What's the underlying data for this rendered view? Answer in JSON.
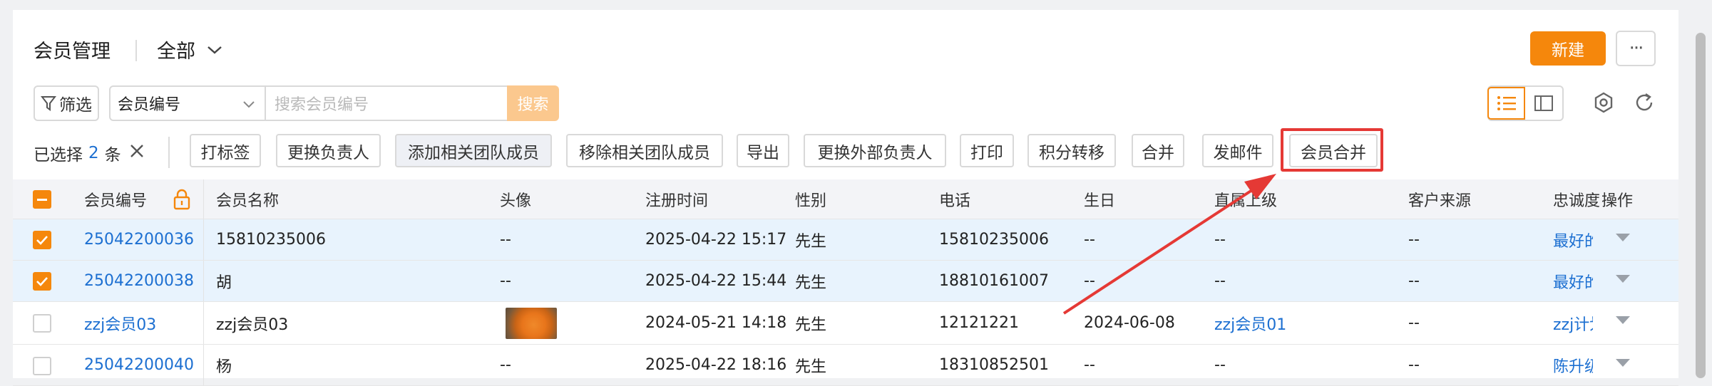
{
  "header": {
    "title": "会员管理",
    "view": "全部",
    "new_label": "新建",
    "more_label": "···"
  },
  "filterbar": {
    "filter_label": "筛选",
    "field_select": "会员编号",
    "search_placeholder": "搜索会员编号",
    "search_label": "搜索"
  },
  "selection": {
    "prefix": "已选择",
    "count": "2",
    "suffix": "条"
  },
  "actions": [
    {
      "label": "打标签"
    },
    {
      "label": "更换负责人"
    },
    {
      "label": "添加相关团队成员"
    },
    {
      "label": "移除相关团队成员"
    },
    {
      "label": "导出"
    },
    {
      "label": "更换外部负责人"
    },
    {
      "label": "打印"
    },
    {
      "label": "积分转移"
    },
    {
      "label": "合并"
    },
    {
      "label": "发邮件"
    },
    {
      "label": "会员合并"
    }
  ],
  "table": {
    "columns": [
      "会员编号",
      "会员名称",
      "头像",
      "注册时间",
      "性别",
      "电话",
      "生日",
      "直属上级",
      "客户来源",
      "忠诚度",
      "操作"
    ],
    "rows": [
      {
        "selected": true,
        "id": "25042200036",
        "name": "15810235006",
        "avatar": "--",
        "registered": "2025-04-22 15:17",
        "gender": "先生",
        "phone": "15810235006",
        "birthday": "--",
        "superior": "--",
        "source": "--",
        "loyalty": "最好的"
      },
      {
        "selected": true,
        "id": "25042200038",
        "name": "胡",
        "avatar": "--",
        "registered": "2025-04-22 15:44",
        "gender": "先生",
        "phone": "18810161007",
        "birthday": "--",
        "superior": "--",
        "source": "--",
        "loyalty": "最好的"
      },
      {
        "selected": false,
        "id": "zzj会员03",
        "name": "zzj会员03",
        "avatar": "",
        "registered": "2024-05-21 14:18",
        "gender": "先生",
        "phone": "12121221",
        "birthday": "2024-06-08",
        "superior": "zzj会员01",
        "source": "--",
        "loyalty": "zzj计划"
      },
      {
        "selected": false,
        "id": "25042200040",
        "name": "杨",
        "avatar": "--",
        "registered": "2025-04-22 18:16",
        "gender": "先生",
        "phone": "18310852501",
        "birthday": "--",
        "superior": "--",
        "source": "--",
        "loyalty": "陈升级"
      }
    ]
  },
  "colors": {
    "accent": "#f5870c",
    "link": "#1c6fd1",
    "selected_row": "#e8f3fd",
    "annotation": "#e53935"
  }
}
